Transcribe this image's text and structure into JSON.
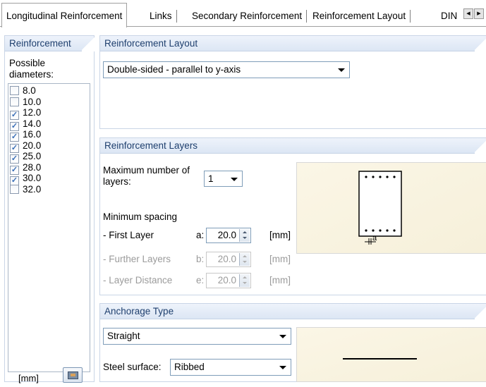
{
  "tabs": [
    {
      "label": "Longitudinal Reinforcement"
    },
    {
      "label": "Links"
    },
    {
      "label": "Secondary Reinforcement"
    },
    {
      "label": "Reinforcement Layout"
    },
    {
      "label": "DIN"
    }
  ],
  "tab_scroll": {
    "left_icon": "arrow-left-icon",
    "right_icon": "arrow-right-icon",
    "left_glyph": "◀",
    "right_glyph": "▶"
  },
  "left_panel": {
    "header": "Reinforcement",
    "label": "Possible diameters:",
    "diameters": [
      {
        "value": "8.0",
        "checked": false
      },
      {
        "value": "10.0",
        "checked": false
      },
      {
        "value": "12.0",
        "checked": true
      },
      {
        "value": "14.0",
        "checked": true
      },
      {
        "value": "16.0",
        "checked": true
      },
      {
        "value": "20.0",
        "checked": true
      },
      {
        "value": "25.0",
        "checked": true
      },
      {
        "value": "28.0",
        "checked": true
      },
      {
        "value": "30.0",
        "checked": true
      },
      {
        "value": "32.0",
        "checked": false
      }
    ],
    "unit": "[mm]",
    "button_icon": "image-edit-icon"
  },
  "reinforcement_layout": {
    "header": "Reinforcement Layout",
    "layout_select_value": "Double-sided - parallel to y-axis"
  },
  "reinforcement_layers": {
    "header": "Reinforcement Layers",
    "max_layers_label": "Maximum number of layers:",
    "max_layers_value": "1",
    "min_spacing_label": "Minimum spacing",
    "first_layer": {
      "label": "- First Layer",
      "symbol": "a:",
      "value": "20.0",
      "unit": "[mm]"
    },
    "further_layers": {
      "label": "- Further Layers",
      "symbol": "b:",
      "value": "20.0",
      "unit": "[mm]"
    },
    "layer_distance": {
      "label": "- Layer Distance",
      "symbol": "e:",
      "value": "20.0",
      "unit": "[mm]"
    },
    "preview_dim_label": "a"
  },
  "anchorage": {
    "header": "Anchorage Type",
    "type_value": "Straight",
    "steel_surface_label": "Steel surface:",
    "steel_surface_value": "Ribbed"
  }
}
